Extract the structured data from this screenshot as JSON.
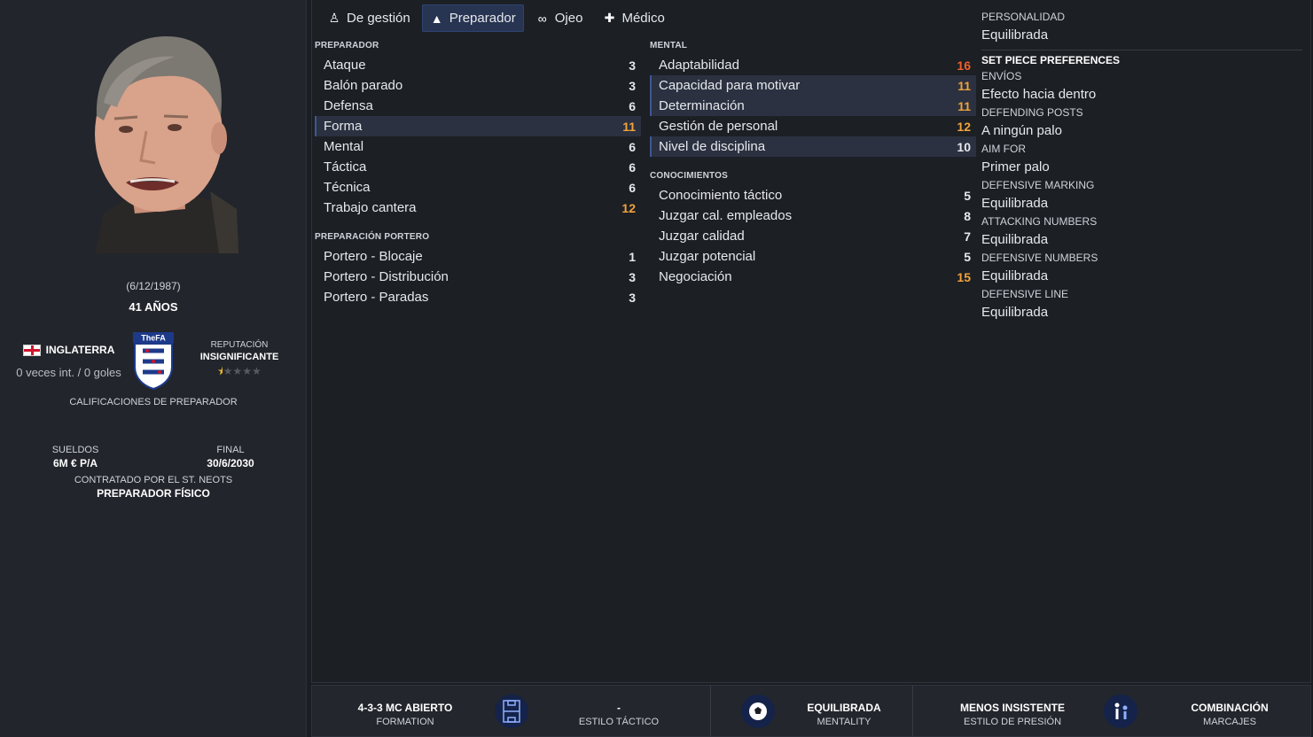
{
  "profile": {
    "birth_date": "(6/12/1987)",
    "age": "41 AÑOS",
    "nation": "INGLATERRA",
    "caps": "0 veces int. / 0 goles",
    "reputation_label": "REPUTACIÓN",
    "reputation_value": "INSIGNIFICANTE",
    "reputation_stars": 0.5,
    "ratings_label": "CALIFICACIONES DE PREPARADOR",
    "wage_label": "SUELDOS",
    "wage_value": "6M € P/A",
    "end_label": "FINAL",
    "end_value": "30/6/2030",
    "contract_label": "CONTRATADO POR EL ST. NEOTS",
    "role": "PREPARADOR FÍSICO",
    "crest_text": "TheFA"
  },
  "tabs": [
    {
      "label": "De gestión",
      "icon": "manager-icon"
    },
    {
      "label": "Preparador",
      "icon": "cone-icon"
    },
    {
      "label": "Ojeo",
      "icon": "binoculars-icon"
    },
    {
      "label": "Médico",
      "icon": "medical-kit-icon"
    }
  ],
  "coaching": {
    "title": "PREPARADOR",
    "rows": [
      {
        "label": "Ataque",
        "value": "3"
      },
      {
        "label": "Balón parado",
        "value": "3"
      },
      {
        "label": "Defensa",
        "value": "6"
      },
      {
        "label": "Forma",
        "value": "11"
      },
      {
        "label": "Mental",
        "value": "6"
      },
      {
        "label": "Táctica",
        "value": "6"
      },
      {
        "label": "Técnica",
        "value": "6"
      },
      {
        "label": "Trabajo cantera",
        "value": "12"
      }
    ]
  },
  "gk_coaching": {
    "title": "PREPARACIÓN PORTERO",
    "rows": [
      {
        "label": "Portero - Blocaje",
        "value": "1"
      },
      {
        "label": "Portero - Distribución",
        "value": "3"
      },
      {
        "label": "Portero - Paradas",
        "value": "3"
      }
    ]
  },
  "mental": {
    "title": "MENTAL",
    "rows": [
      {
        "label": "Adaptabilidad",
        "value": "16"
      },
      {
        "label": "Capacidad para motivar",
        "value": "11"
      },
      {
        "label": "Determinación",
        "value": "11"
      },
      {
        "label": "Gestión de personal",
        "value": "12"
      },
      {
        "label": "Nivel de disciplina",
        "value": "10"
      }
    ]
  },
  "knowledge": {
    "title": "CONOCIMIENTOS",
    "rows": [
      {
        "label": "Conocimiento táctico",
        "value": "5"
      },
      {
        "label": "Juzgar cal. empleados",
        "value": "8"
      },
      {
        "label": "Juzgar calidad",
        "value": "7"
      },
      {
        "label": "Juzgar potencial",
        "value": "5"
      },
      {
        "label": "Negociación",
        "value": "15"
      }
    ]
  },
  "personality": {
    "label": "PERSONALIDAD",
    "value": "Equilibrada"
  },
  "set_pieces": {
    "title": "SET PIECE PREFERENCES",
    "items": [
      {
        "label": "ENVÍOS",
        "value": "Efecto hacia dentro"
      },
      {
        "label": "DEFENDING POSTS",
        "value": "A ningún palo"
      },
      {
        "label": "AIM FOR",
        "value": "Primer palo"
      },
      {
        "label": "DEFENSIVE MARKING",
        "value": "Equilibrada"
      },
      {
        "label": "ATTACKING NUMBERS",
        "value": "Equilibrada"
      },
      {
        "label": "DEFENSIVE NUMBERS",
        "value": "Equilibrada"
      },
      {
        "label": "DEFENSIVE LINE",
        "value": "Equilibrada"
      }
    ]
  },
  "bottom": {
    "formation_value": "4-3-3 MC ABIERTO",
    "formation_label": "FORMATION",
    "style_value": "-",
    "style_label": "ESTILO TÁCTICO",
    "mentality_value": "EQUILIBRADA",
    "mentality_label": "MENTALITY",
    "press_value": "MENOS INSISTENTE",
    "press_label": "ESTILO DE PRESIÓN",
    "marking_value": "COMBINACIÓN",
    "marking_label": "MARCAJES"
  },
  "colors": {
    "accent": "#273452",
    "value_mid": "#f2a33a",
    "value_high": "#f0612c"
  }
}
